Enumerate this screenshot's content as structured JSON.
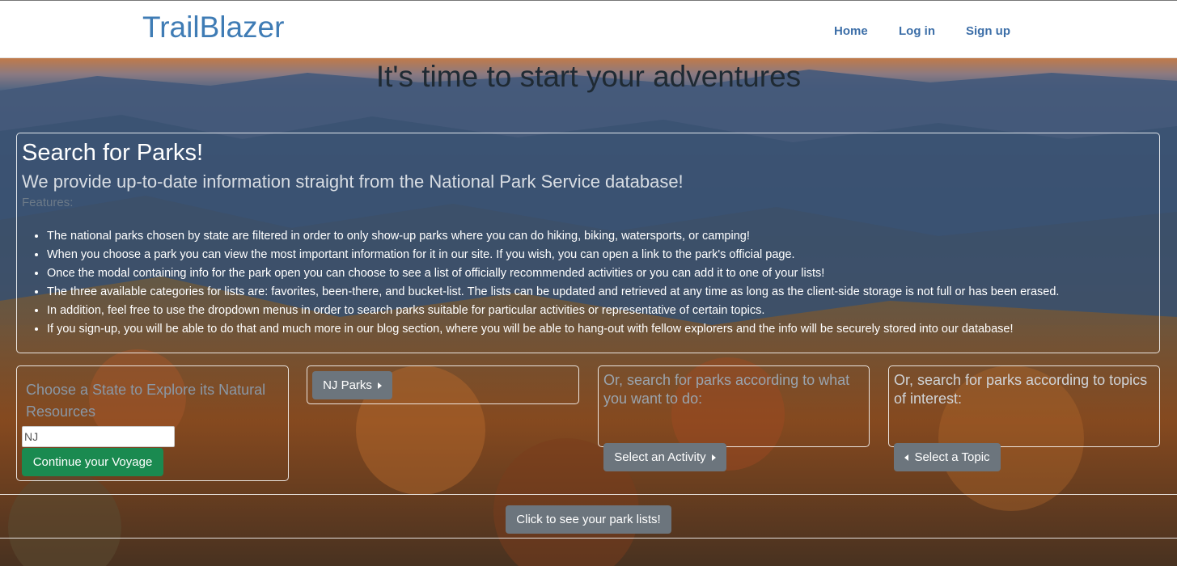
{
  "navbar": {
    "brand": "TrailBlazer",
    "links": [
      "Home",
      "Log in",
      "Sign up"
    ]
  },
  "hero": {
    "title": "It's time to start your adventures"
  },
  "search_section": {
    "title": "Search for Parks!",
    "subtitle": "We provide up-to-date information straight from the National Park Service database!",
    "features_label": "Features:",
    "features": [
      "The national parks chosen by state are filtered in order to only show-up parks where you can do hiking, biking, watersports, or camping!",
      "When you choose a park you can view the most important information for it in our site. If you wish, you can open a link to the park's official page.",
      "Once the modal containing info for the park open you can choose to see a list of officially recommended activities or you can add it to one of your lists!",
      "The three available categories for lists are: favorites, been-there, and bucket-list. The lists can be updated and retrieved at any time as long as the client-side storage is not full or has been erased.",
      "In addition, feel free to use the dropdown menus in order to search parks suitable for particular activities or representative of certain topics.",
      "If you sign-up, you will be able to do that and much more in our blog section, where you will be able to hang-out with fellow explorers and the info will be securely stored into our database!"
    ]
  },
  "state_search": {
    "label": "Choose a State to Explore its Natural Resources",
    "input_value": "NJ",
    "button": "Continue your Voyage"
  },
  "parks_dropdown": {
    "label": "NJ Parks"
  },
  "activity_search": {
    "text": "Or, search for parks according to what you want to do:",
    "button": "Select an Activity"
  },
  "topic_search": {
    "text": "Or, search for parks according to topics of interest:",
    "button": "Select a Topic"
  },
  "lists_button": "Click to see your park lists!",
  "colors": {
    "brand": "#3f7cb5",
    "nav_link": "#3d6fa8",
    "green_button": "#1a8a50",
    "gray_button": "#6c757d"
  }
}
